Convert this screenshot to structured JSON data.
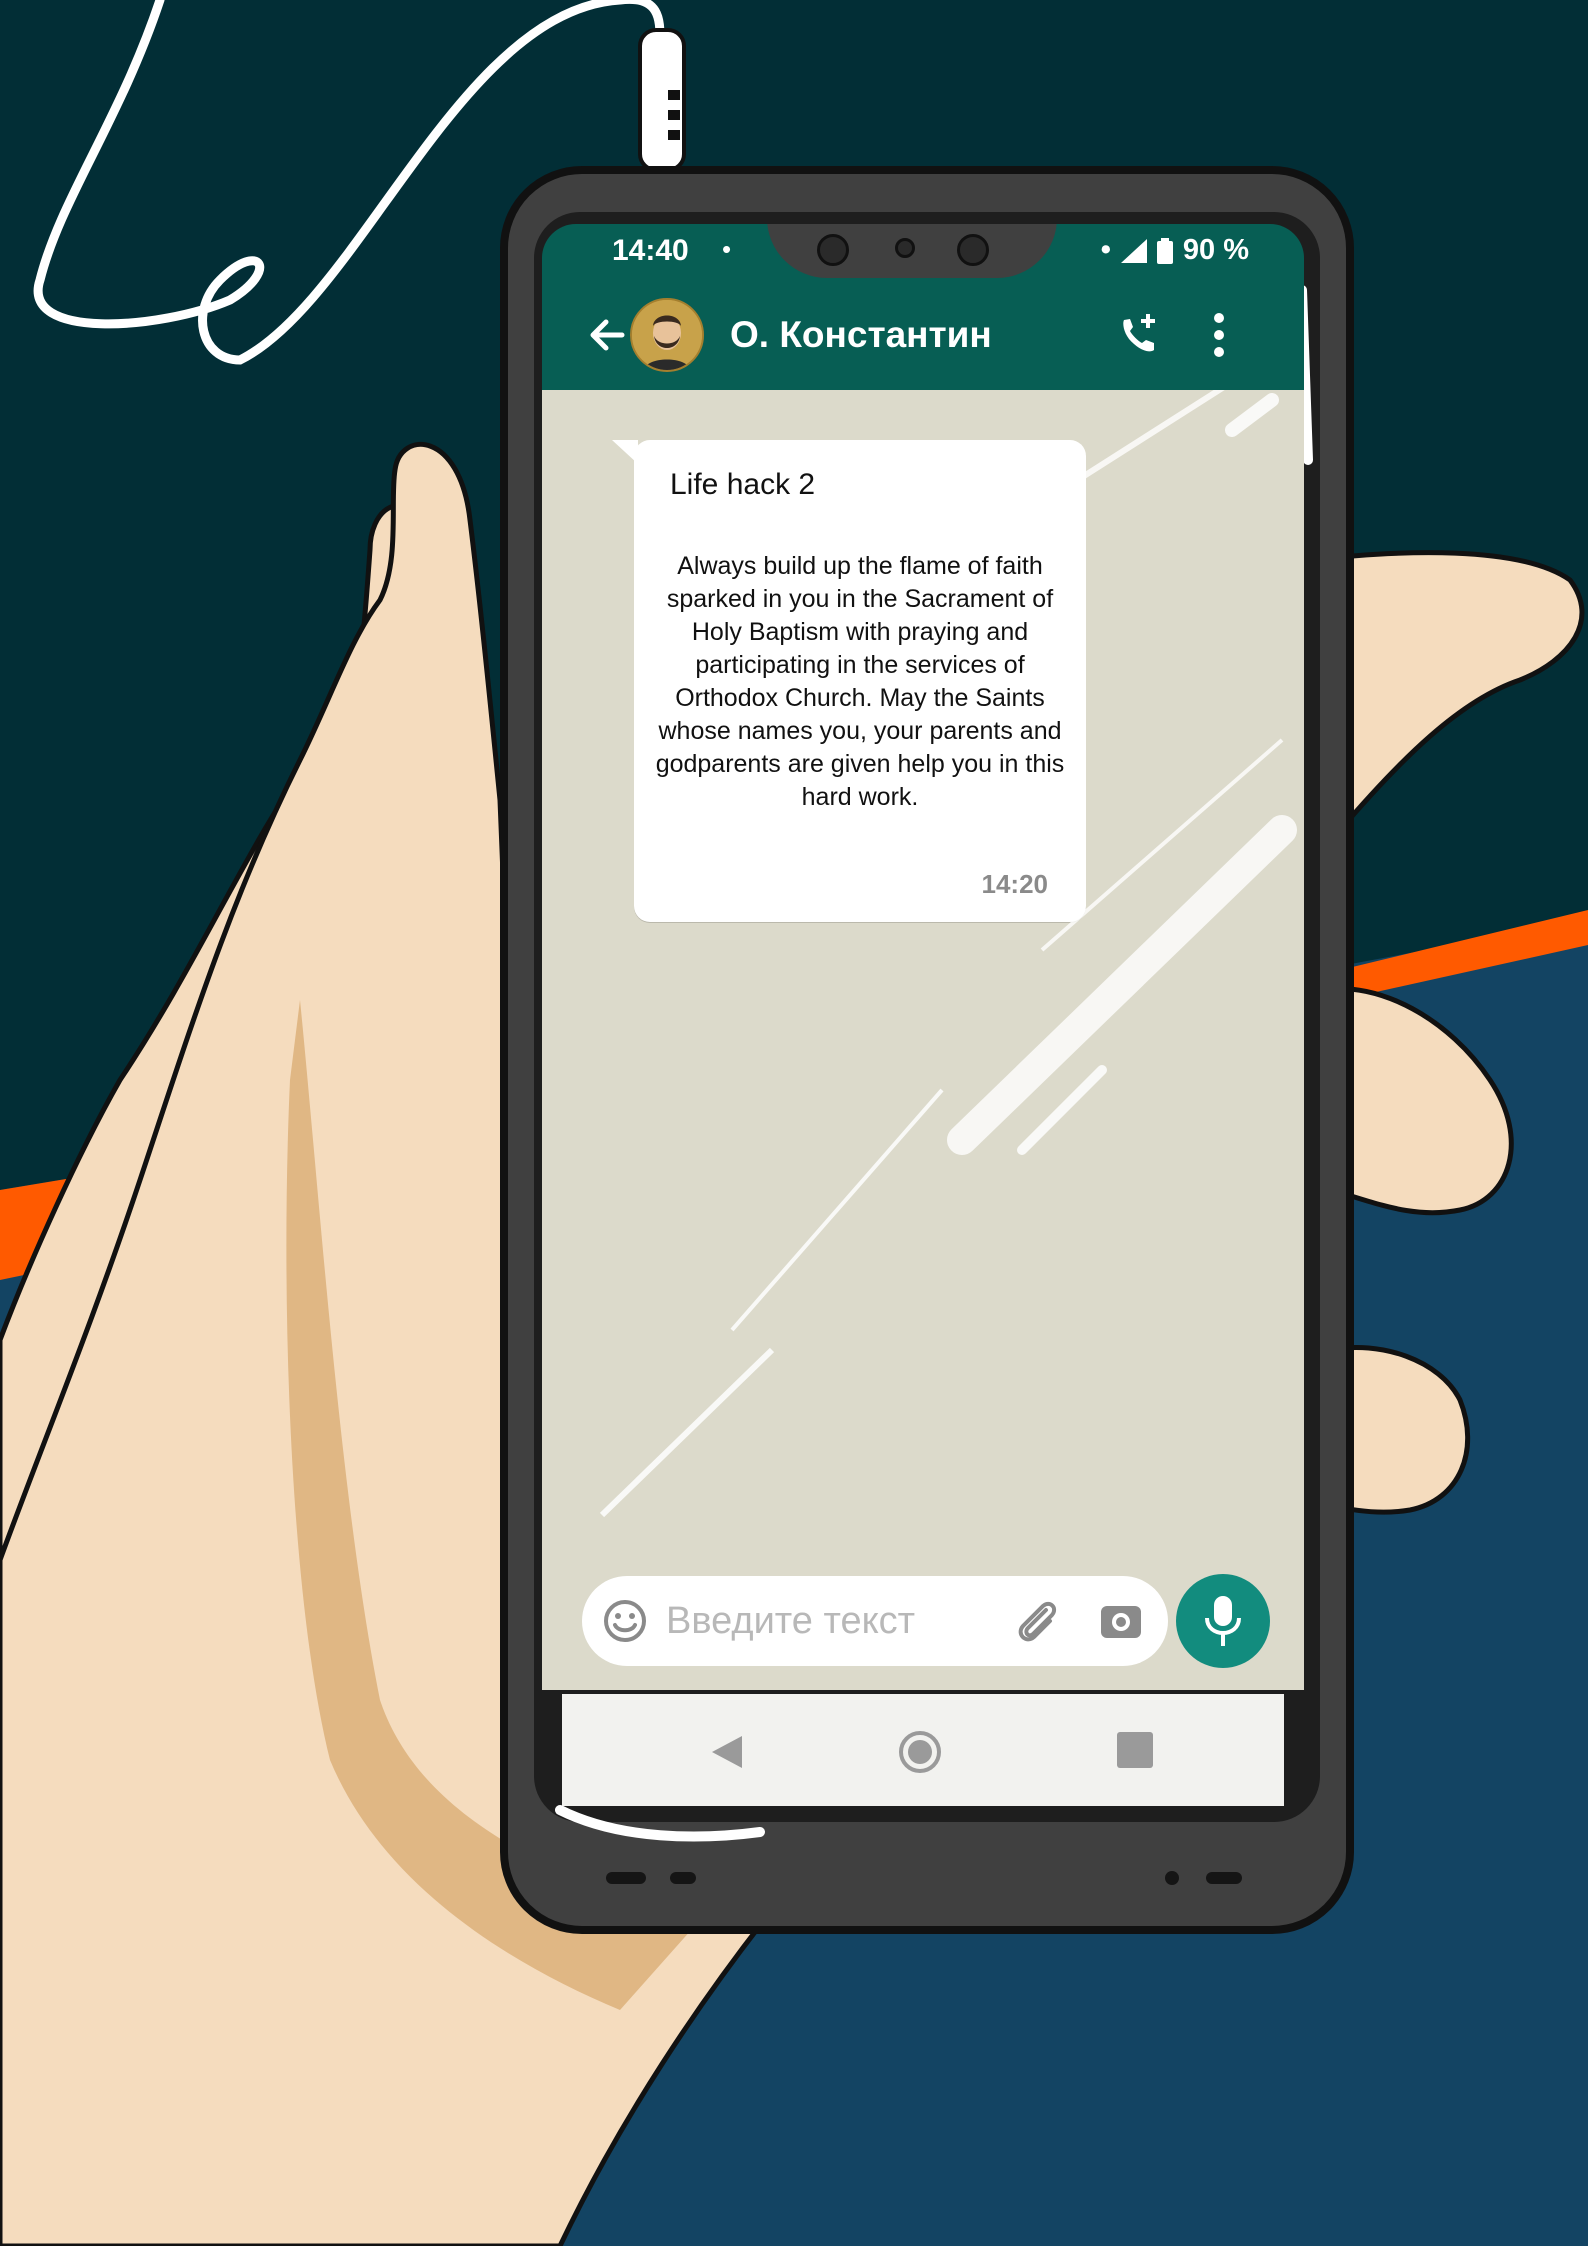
{
  "status_bar": {
    "time": "14:40",
    "dot_left": "•",
    "dot_right": "•",
    "battery": "90 %"
  },
  "chat_header": {
    "back_icon": "arrow-left-icon",
    "contact_name": "О. Константин",
    "call_icon": "add-call-icon",
    "menu_icon": "more-vertical-icon"
  },
  "message": {
    "title": "Life hack 2",
    "body": "Always build up the flame of faith sparked in you in the Sacrament of Holy Baptism with praying and participating in the services of Orthodox Church. May the Saints whose names you, your parents and godparents are given help you in this hard work.",
    "time": "14:20"
  },
  "composer": {
    "placeholder": "Введите текст",
    "emoji_icon": "smiley-icon",
    "attach_icon": "paperclip-icon",
    "camera_icon": "camera-icon",
    "mic_icon": "microphone-icon"
  },
  "nav_bar": {
    "back_icon": "triangle-back-icon",
    "home_icon": "circle-home-icon",
    "recents_icon": "square-recents-icon"
  },
  "colors": {
    "header_green": "#075e54",
    "accent_green": "#128c7e",
    "chat_background": "#dcdacb",
    "bg_top": "#022e36",
    "bg_bottom": "#134463",
    "stripe_orange": "#ff5a00",
    "skin": "#f5dcbe",
    "skin_shadow": "#dcb07a",
    "phone_body": "#404040"
  }
}
